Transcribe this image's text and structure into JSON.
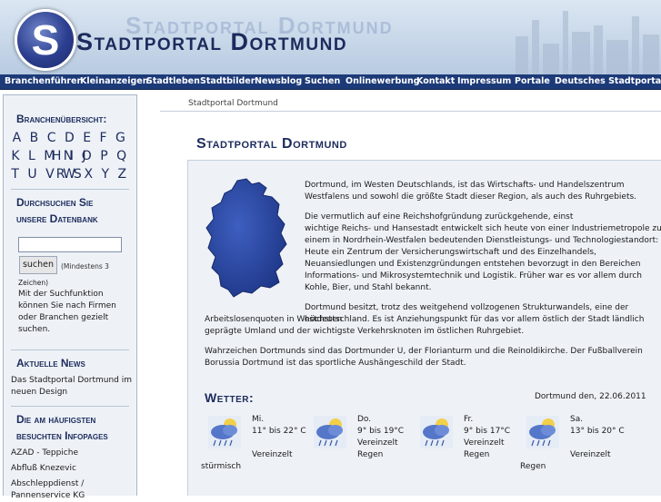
{
  "header": {
    "logo_letter": "S",
    "title_ghost": "Stadtportal Dortmund",
    "title": "Stadtportal Dortmund"
  },
  "nav": {
    "items": [
      "Branchenführer",
      "Kleinanzeigen",
      "Stadtleben",
      "Stadtbilder",
      "Newsblog",
      "Suchen",
      "Onlinewerbung",
      "Kontakt",
      "Impressum",
      "Portale",
      "Deutsches Stadtportal"
    ]
  },
  "sidebar": {
    "branchen_heading": "Branchenübersicht:",
    "letters_row1": [
      "A",
      "B",
      "C",
      "D",
      "E",
      "F",
      "G",
      "H",
      "I",
      "J"
    ],
    "letters_row2": [
      "K",
      "L",
      "M",
      "N",
      "O",
      "P",
      "Q",
      "R",
      "S"
    ],
    "letters_row3": [
      "T",
      "U",
      "V",
      "W",
      "X",
      "Y",
      "Z"
    ],
    "search_heading_1": "Durchsuchen Sie",
    "search_heading_2": "unsere Datenbank",
    "search_value": "",
    "search_button": "suchen",
    "search_hint": "(Mindestens 3",
    "search_hint_2": "Zeichen)",
    "search_desc": [
      "Mit der Suchfunktion",
      "können Sie nach Firmen",
      "oder Branchen gezielt",
      "suchen."
    ],
    "news_heading": "Aktuelle News",
    "news_items": [
      "Das Stadtportal Dortmund im",
      "neuen Design"
    ],
    "infopages_heading_1": "Die am häufigsten",
    "infopages_heading_2": "besuchten Infopages",
    "infopages": [
      "AZAD - Teppiche",
      "Abfluß Knezevic",
      "Abschleppdienst /",
      "Pannenservice KG"
    ]
  },
  "main": {
    "breadcrumb": "Stadtportal Dortmund",
    "page_title": "Stadtportal Dortmund",
    "p1": [
      "Dortmund, im Westen Deutschlands, ist das Wirtschafts- und Handelszentrum",
      "Westfalens und sowohl die größte Stadt dieser Region, als auch des Ruhrgebiets."
    ],
    "p2": [
      "Die vermutlich auf eine Reichshofgründung zurückgehende, einst",
      "wichtige Reichs- und Hansestadt entwickelt sich heute von einer Industriemetropole zu",
      "einem in Nordrhein-Westfalen bedeutenden Dienstleistungs- und Technologiestandort:",
      "Heute ein Zentrum der Versicherungswirtschaft und des Einzelhandels,",
      "Neuansiedlungen und Existenzgründungen entstehen bevorzugt in den Bereichen",
      "Informations- und Mikrosystemtechnik und Logistik. Früher war es vor allem durch",
      "Kohle, Bier, und Stahl bekannt."
    ],
    "p3": [
      "Dortmund besitzt, trotz des weitgehend vollzogenen Strukturwandels, eine der höchsten",
      "Arbeitslosenquoten in Westdeutschland. Es ist Anziehungspunkt für das vor allem östlich der Stadt ländlich",
      "geprägte Umland und der wichtigste Verkehrsknoten im östlichen Ruhrgebiet."
    ],
    "p4": [
      "Wahrzeichen Dortmunds sind das Dortmunder U, der Florianturm und die Reinoldikirche. Der Fußballverein",
      "Borussia Dortmund ist das sportliche Aushängeschild der Stadt."
    ]
  },
  "weather": {
    "title": "Wetter:",
    "date": "Dortmund den, 22.06.2011",
    "days": [
      {
        "day": "Mi.",
        "temp": "11° bis 22° C",
        "desc1": "Vereinzelt",
        "desc2": "stürmisch",
        "icon": "cloud-rain-icon"
      },
      {
        "day": "Do.",
        "temp": "9° bis 19°C",
        "desc1": "Vereinzelt",
        "desc2": "Regen",
        "icon": "cloud-rain-icon"
      },
      {
        "day": "Fr.",
        "temp": "9° bis 17°C",
        "desc1": "Vereinzelt",
        "desc2": "Regen",
        "icon": "cloud-rain-icon"
      },
      {
        "day": "Sa.",
        "temp": "13° bis 20° C",
        "desc1": "Vereinzelt",
        "desc2": "Regen",
        "icon": "cloud-rain-icon"
      }
    ]
  },
  "colors": {
    "nav_bg": "#1d3a78",
    "heading": "#1c2b5c",
    "panel_bg": "#eef2f7"
  }
}
